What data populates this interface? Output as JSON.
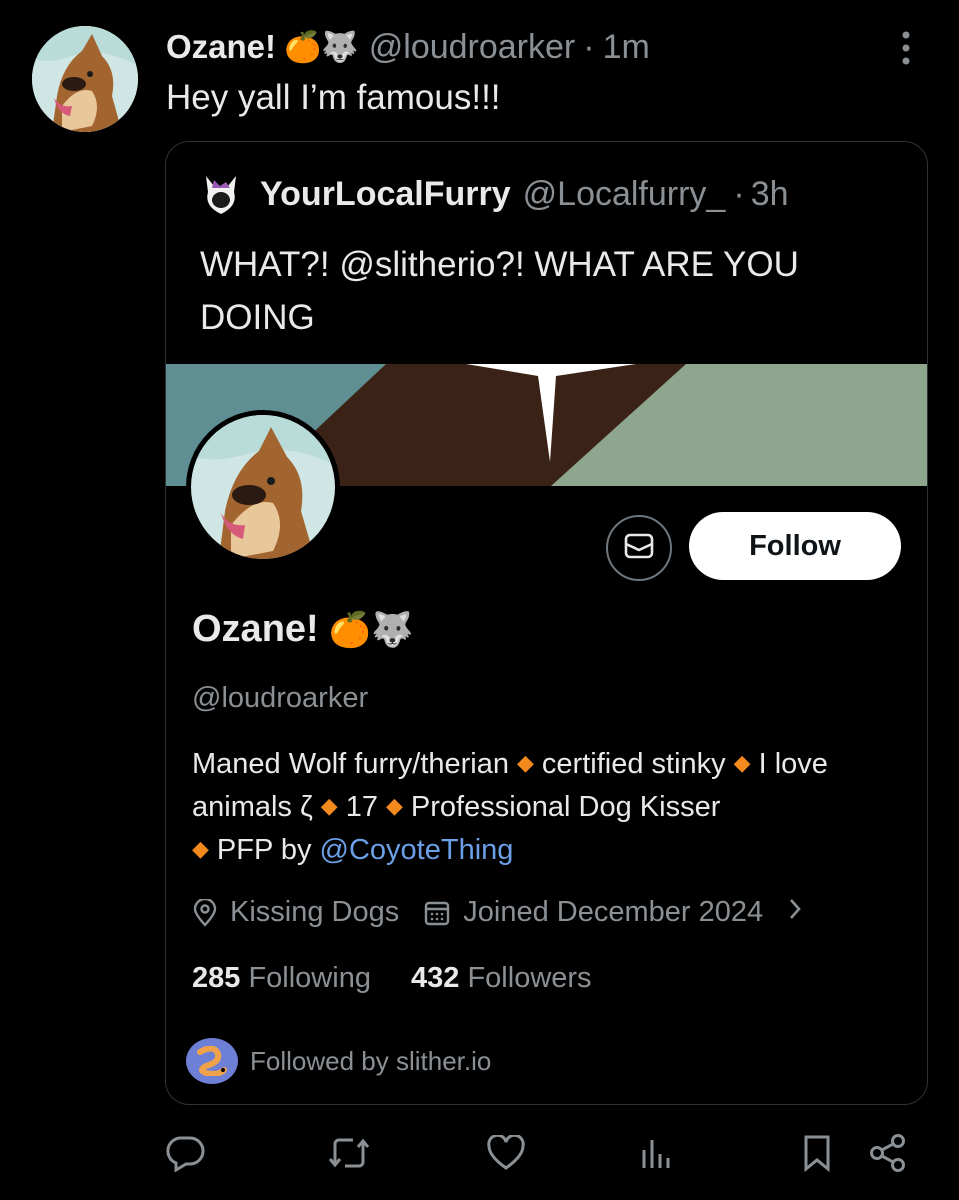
{
  "tweet": {
    "author_name": "Ozane!",
    "author_emoji": "🍊🐺",
    "author_handle": "@loudroarker",
    "separator": "·",
    "time": "1m",
    "text": "Hey yall I’m famous!!!"
  },
  "quote": {
    "author_name": "YourLocalFurry",
    "author_handle": "@Localfurry_",
    "separator": "·",
    "time": "3h",
    "text": "WHAT?! @slitherio?! WHAT ARE YOU DOING"
  },
  "profile_card": {
    "follow_label": "Follow",
    "name": "Ozane!",
    "name_emoji": "🍊🐺",
    "handle": "@loudroarker",
    "bio": {
      "part1": "Maned Wolf furry/therian",
      "part2": "certified stinky",
      "part3": "I love animals ζ",
      "part4": "17",
      "part5": "Professional Dog Kisser",
      "part6": "PFP by",
      "mention": "@CoyoteThing",
      "diamond": "◆"
    },
    "location": "Kissing Dogs",
    "joined": "Joined December 2024",
    "following_count": "285",
    "following_label": "Following",
    "followers_count": "432",
    "followers_label": "Followers",
    "followed_by": "Followed by slither.io"
  },
  "colors": {
    "background": "#000000",
    "text": "#e7e9ea",
    "muted": "#8b9095",
    "link": "#6b9fe6",
    "accent_diamond": "#f4891e",
    "banner_teal": "#5f8f93",
    "banner_brown": "#3a2316",
    "banner_sage": "#8fa68e"
  },
  "icons": [
    "more-icon",
    "message-icon",
    "location-icon",
    "calendar-icon",
    "chevron-right-icon",
    "reply-icon",
    "retweet-icon",
    "like-icon",
    "views-icon",
    "bookmark-icon",
    "share-icon"
  ]
}
